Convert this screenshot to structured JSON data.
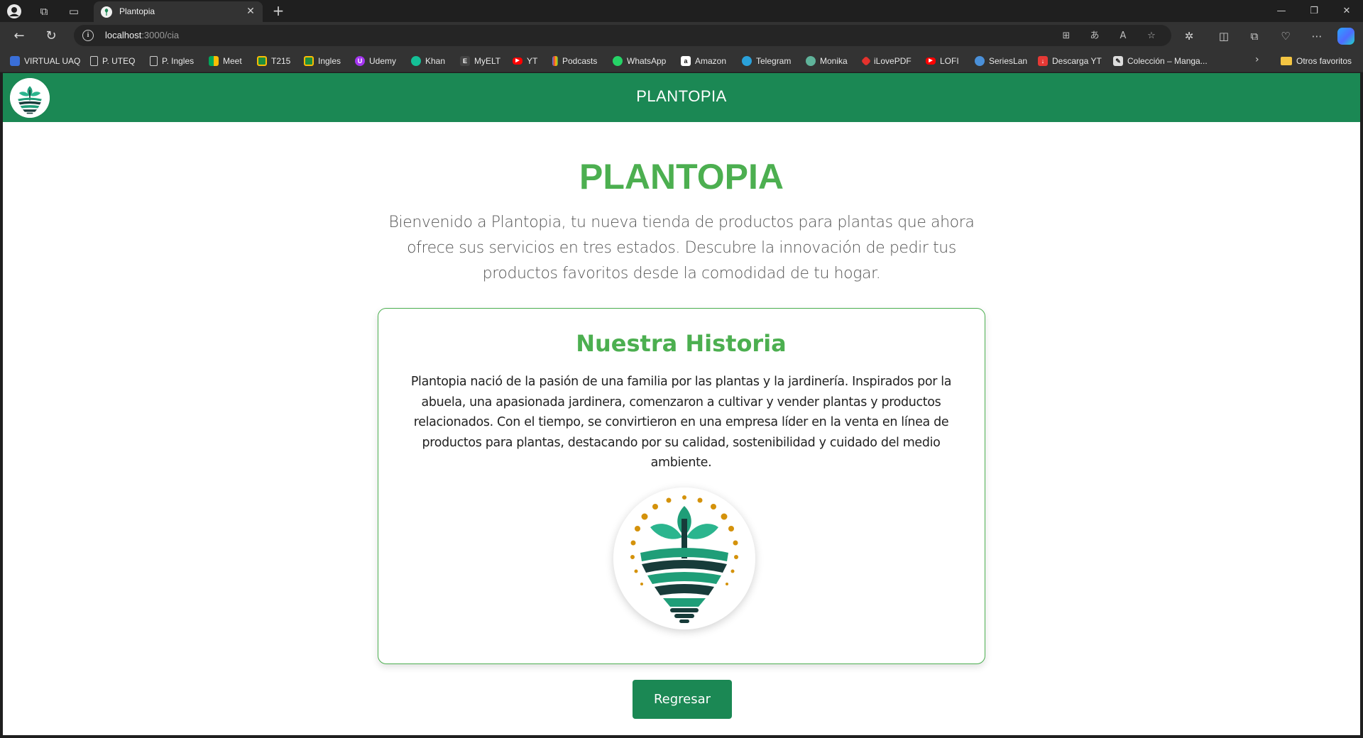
{
  "browser": {
    "tab": {
      "title": "Plantopia"
    },
    "address": {
      "host": "localhost",
      "path": ":3000/cia"
    },
    "bookmarks": [
      {
        "label": "VIRTUAL UAQ",
        "icon": "uaq-icon",
        "color": "#3a6fd8"
      },
      {
        "label": "P. UTEQ",
        "icon": "page-icon",
        "color": "#9a9a9a"
      },
      {
        "label": "P. Ingles",
        "icon": "page-icon",
        "color": "#9a9a9a"
      },
      {
        "label": "Meet",
        "icon": "meet-icon",
        "color": "#00a65a"
      },
      {
        "label": "T215",
        "icon": "classroom-icon",
        "color": "#1e8e3e"
      },
      {
        "label": "Ingles",
        "icon": "classroom-icon",
        "color": "#1e8e3e"
      },
      {
        "label": "Udemy",
        "icon": "udemy-icon",
        "color": "#a435f0"
      },
      {
        "label": "Khan",
        "icon": "khan-icon",
        "color": "#14bf96"
      },
      {
        "label": "MyELT",
        "icon": "myelt-icon",
        "color": "#555555"
      },
      {
        "label": "YT",
        "icon": "youtube-icon",
        "color": "#ff0000"
      },
      {
        "label": "Podcasts",
        "icon": "podcasts-icon",
        "color": "#f4b400"
      },
      {
        "label": "WhatsApp",
        "icon": "whatsapp-icon",
        "color": "#25d366"
      },
      {
        "label": "Amazon",
        "icon": "amazon-icon",
        "color": "#ffffff"
      },
      {
        "label": "Telegram",
        "icon": "telegram-icon",
        "color": "#2aa1da"
      },
      {
        "label": "Monika",
        "icon": "monika-icon",
        "color": "#5fb39a"
      },
      {
        "label": "iLovePDF",
        "icon": "ilovepdf-icon",
        "color": "#e5322d"
      },
      {
        "label": "LOFI",
        "icon": "youtube-icon",
        "color": "#ff0000"
      },
      {
        "label": "SeriesLan",
        "icon": "serieslan-icon",
        "color": "#4a90d9"
      },
      {
        "label": "Descarga YT",
        "icon": "download-icon",
        "color": "#e53935"
      },
      {
        "label": "Colección – Manga...",
        "icon": "manga-icon",
        "color": "#dddddd"
      }
    ],
    "other_favorites": "Otros favoritos"
  },
  "header": {
    "title": "PLANTOPIA"
  },
  "hero": {
    "title": "PLANTOPIA",
    "text": "Bienvenido a Plantopia, tu nueva tienda de productos para plantas que ahora ofrece sus servicios en tres estados. Descubre la innovación de pedir tus productos favoritos desde la comodidad de tu hogar."
  },
  "history": {
    "title": "Nuestra Historia",
    "text": "Plantopia nació de la pasión de una familia por las plantas y la jardinería. Inspirados por la abuela, una apasionada jardinera, comenzaron a cultivar y vender plantas y productos relacionados. Con el tiempo, se convirtieron en una empresa líder en la venta en línea de productos para plantas, destacando por su calidad, sostenibilidad y cuidado del medio ambiente."
  },
  "actions": {
    "back_label": "Regresar"
  },
  "colors": {
    "brand_green": "#1b8854",
    "title_green": "#4caf50",
    "logo_gold": "#d4920b"
  }
}
